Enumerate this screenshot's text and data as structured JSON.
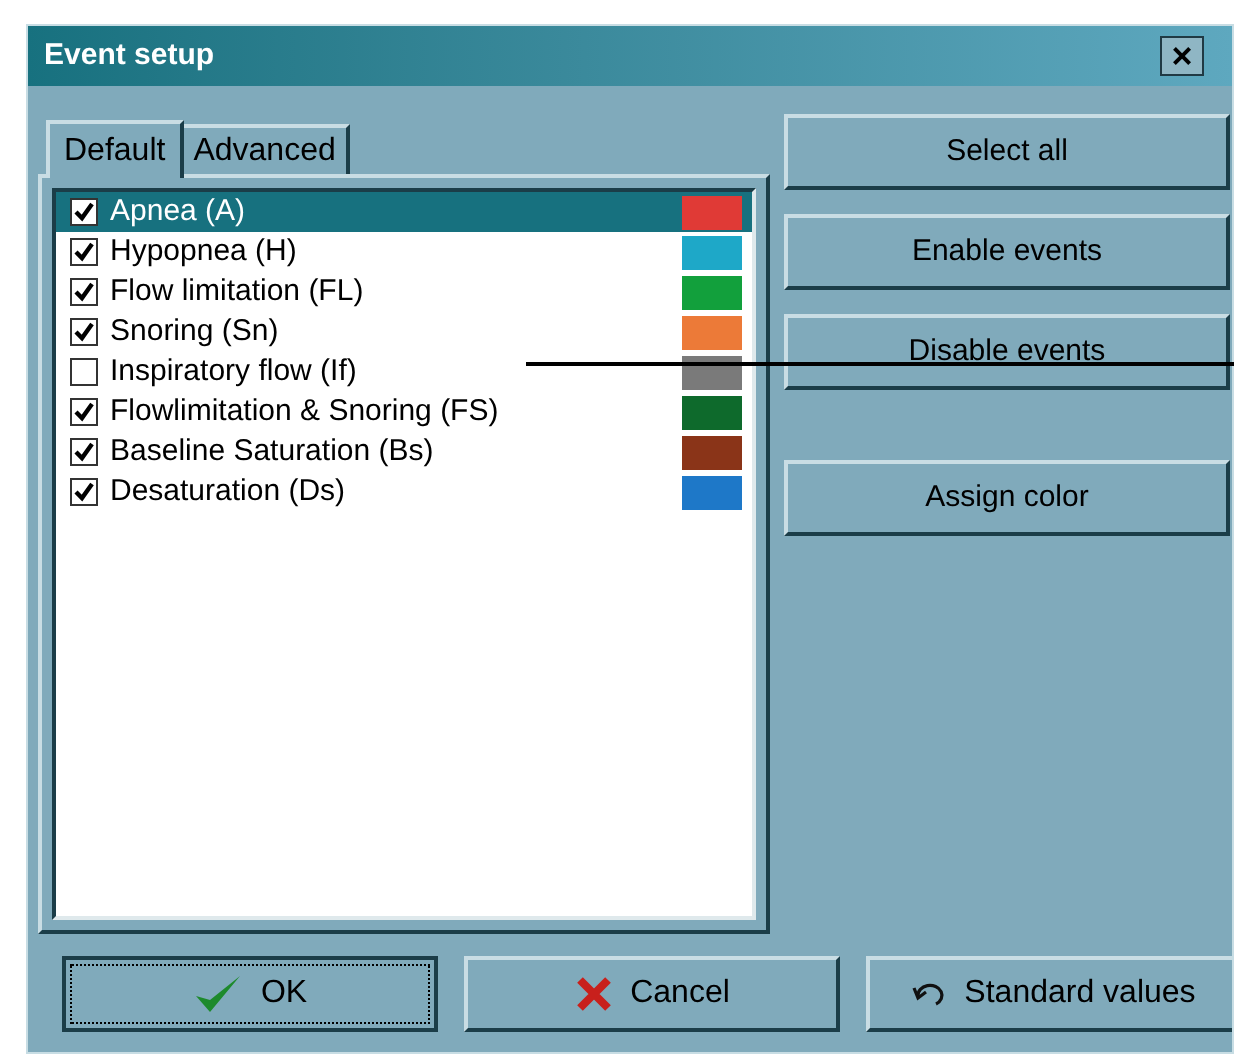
{
  "window": {
    "title": "Event setup",
    "close": "×"
  },
  "tabs": [
    {
      "label": "Default",
      "selected": true
    },
    {
      "label": "Advanced",
      "selected": false
    }
  ],
  "events": [
    {
      "label": "Apnea (A)",
      "checked": true,
      "selected": true,
      "color": "#e03a36"
    },
    {
      "label": "Hypopnea (H)",
      "checked": true,
      "selected": false,
      "color": "#1ea8c8"
    },
    {
      "label": "Flow limitation (FL)",
      "checked": true,
      "selected": false,
      "color": "#12a03c"
    },
    {
      "label": "Snoring (Sn)",
      "checked": true,
      "selected": false,
      "color": "#ec7a38"
    },
    {
      "label": "Inspiratory flow (If)",
      "checked": false,
      "selected": false,
      "color": "#7a7a7a"
    },
    {
      "label": "Flowlimitation & Snoring (FS)",
      "checked": true,
      "selected": false,
      "color": "#0e6a2c"
    },
    {
      "label": "Baseline Saturation (Bs)",
      "checked": true,
      "selected": false,
      "color": "#8a3418"
    },
    {
      "label": "Desaturation (Ds)",
      "checked": true,
      "selected": false,
      "color": "#1e78c8"
    }
  ],
  "side_buttons": [
    {
      "label": "Select all"
    },
    {
      "label": "Enable events"
    },
    {
      "label": "Disable events"
    }
  ],
  "assign_button": {
    "label": "Assign color"
  },
  "bottom_buttons": [
    {
      "label": "OK",
      "kind": "ok",
      "focused": true
    },
    {
      "label": "Cancel",
      "kind": "cancel",
      "focused": false
    },
    {
      "label": "Standard values",
      "kind": "reset",
      "focused": false
    }
  ]
}
